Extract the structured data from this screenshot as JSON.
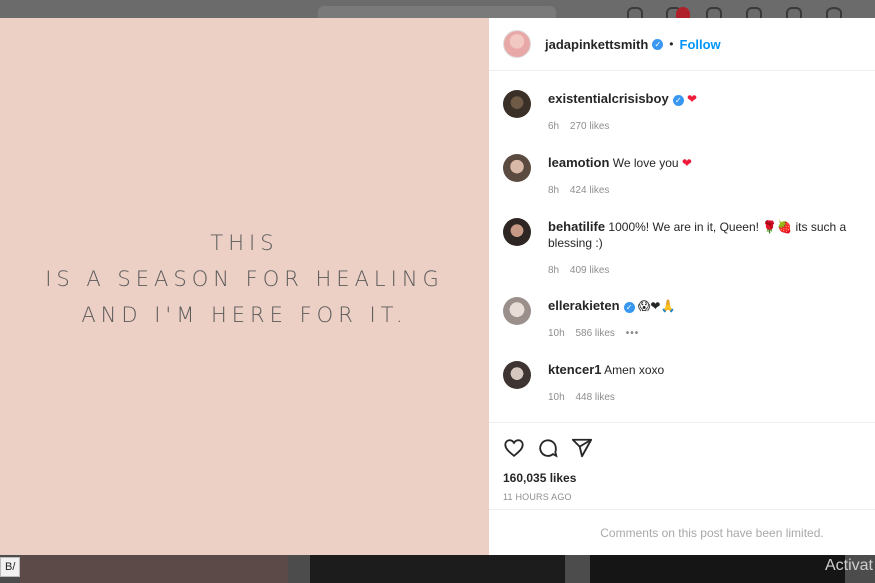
{
  "post_image": {
    "lines": [
      "THIS",
      "IS A SEASON FOR HEALING",
      "AND I'M HERE FOR IT."
    ]
  },
  "header": {
    "username": "jadapinkettsmith",
    "separator": "•",
    "follow_label": "Follow"
  },
  "comments": [
    {
      "username": "existentialcrisisboy",
      "verified": true,
      "text": "",
      "emoji": "❤",
      "time": "6h",
      "likes": "270 likes"
    },
    {
      "username": "leamotion",
      "verified": false,
      "text": "We love you",
      "emoji": "❤",
      "time": "8h",
      "likes": "424 likes"
    },
    {
      "username": "behatilife",
      "verified": false,
      "text": "1000%! We are in it, Queen! 🌹🍓 its such a blessing :)",
      "emoji": "",
      "time": "8h",
      "likes": "409 likes"
    },
    {
      "username": "ellerakieten",
      "verified": true,
      "text": "",
      "emoji": "😱❤🙏",
      "time": "10h",
      "likes": "586 likes",
      "more": "•••"
    },
    {
      "username": "ktencer1",
      "verified": false,
      "text": "Amen xoxo",
      "emoji": "",
      "time": "10h",
      "likes": "448 likes"
    }
  ],
  "footer": {
    "likes": "160,035 likes",
    "time_ago": "11 HOURS AGO",
    "comments_limited": "Comments on this post have been limited."
  },
  "browser": {
    "url_tip": "B/",
    "watermark": "Activat"
  },
  "colors": {
    "image_bg": "#eccfc5",
    "link_blue": "#0095f6",
    "heart_red": "#ed1c3a"
  }
}
